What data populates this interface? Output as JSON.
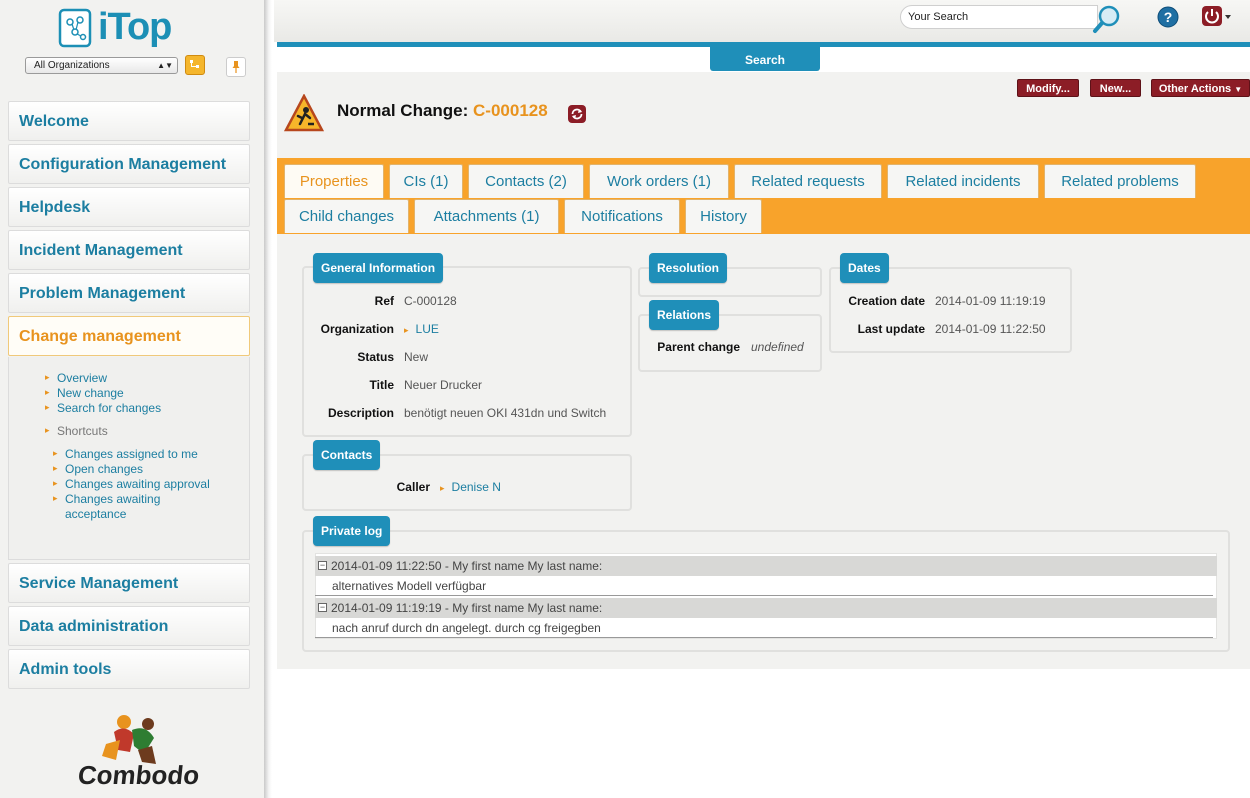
{
  "app": {
    "logo_text": "iTop",
    "footer_logo": "Combodo"
  },
  "sidebar": {
    "org_select": "All Organizations",
    "menus": [
      {
        "label": "Welcome"
      },
      {
        "label": "Configuration Management"
      },
      {
        "label": "Helpdesk"
      },
      {
        "label": "Incident Management"
      },
      {
        "label": "Problem Management"
      },
      {
        "label": "Change management"
      },
      {
        "label": "Service Management"
      },
      {
        "label": "Data administration"
      },
      {
        "label": "Admin tools"
      }
    ],
    "submenu": {
      "links": [
        "Overview",
        "New change",
        "Search for changes"
      ],
      "shortcuts_label": "Shortcuts",
      "shortcuts": [
        "Changes assigned to me",
        "Open changes",
        "Changes awaiting approval",
        "Changes awaiting",
        "acceptance"
      ]
    }
  },
  "topbar": {
    "search_placeholder": "Your Search",
    "search_tab": "Search"
  },
  "actions": {
    "modify": "Modify...",
    "new": "New...",
    "other": "Other Actions"
  },
  "object": {
    "class_label": "Normal Change:",
    "ref": "C-000128"
  },
  "tabs": {
    "row1": [
      "Properties",
      "CIs (1)",
      "Contacts (2)",
      "Work orders (1)",
      "Related requests",
      "Related incidents",
      "Related problems"
    ],
    "row2": [
      "Child changes",
      "Attachments (1)",
      "Notifications",
      "History"
    ]
  },
  "general": {
    "legend": "General Information",
    "ref_label": "Ref",
    "ref_value": "C-000128",
    "org_label": "Organization",
    "org_value": "LUE",
    "status_label": "Status",
    "status_value": "New",
    "title_label": "Title",
    "title_value": "Neuer Drucker",
    "desc_label": "Description",
    "desc_value": "benötigt neuen OKI 431dn und Switch"
  },
  "contacts": {
    "legend": "Contacts",
    "caller_label": "Caller",
    "caller_value": "Denise N"
  },
  "resolution": {
    "legend": "Resolution"
  },
  "relations": {
    "legend": "Relations",
    "parent_label": "Parent change",
    "parent_value": "undefined"
  },
  "dates": {
    "legend": "Dates",
    "creation_label": "Creation date",
    "creation_value": "2014-01-09 11:19:19",
    "update_label": "Last update",
    "update_value": "2014-01-09 11:22:50"
  },
  "private_log": {
    "legend": "Private log",
    "entries": [
      {
        "header": "2014-01-09 11:22:50 - My first name My last name:",
        "text": "alternatives Modell verfügbar"
      },
      {
        "header": "2014-01-09 11:19:19 - My first name My last name:",
        "text": "nach anruf durch dn angelegt. durch cg freigegben"
      }
    ]
  },
  "colors": {
    "accent": "#1f8fb9",
    "orange": "#f8a32b",
    "dark_red": "#8c1d26"
  }
}
